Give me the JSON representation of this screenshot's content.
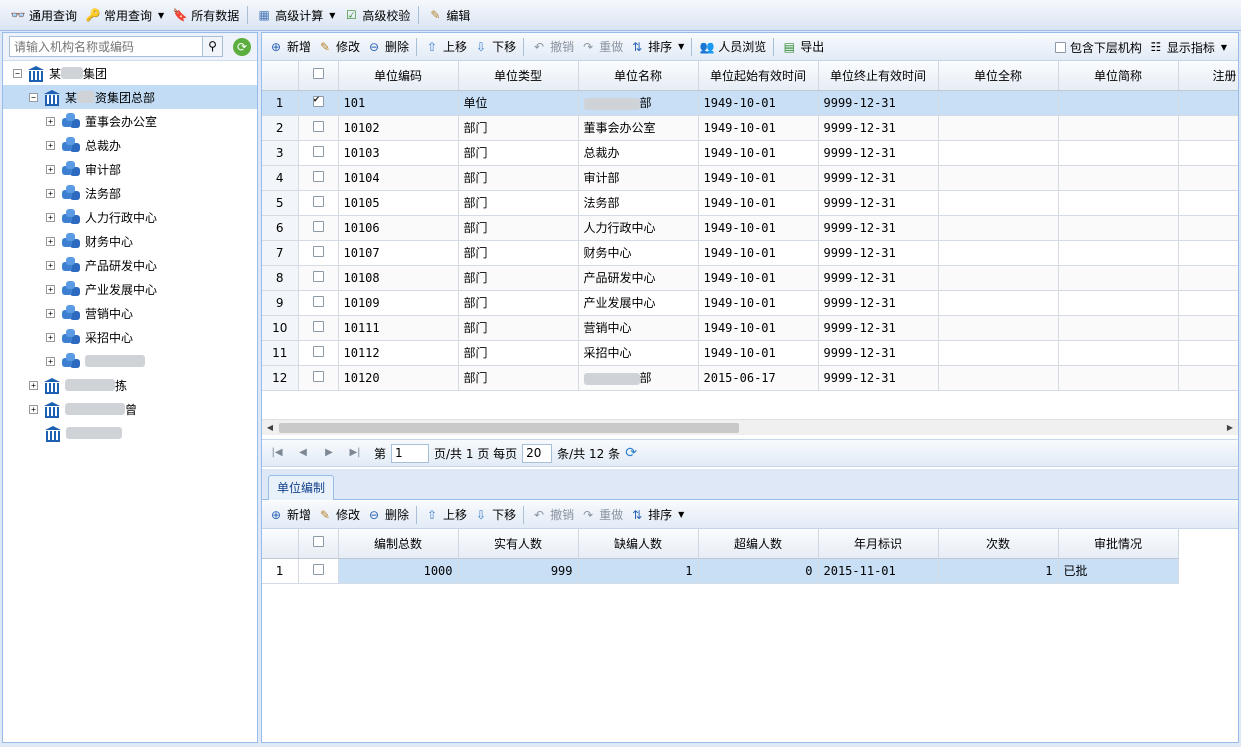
{
  "topbar": {
    "items": [
      {
        "label": "通用查询",
        "icon": "binoculars-icon",
        "dropdown": false
      },
      {
        "label": "常用查询",
        "icon": "query-icon",
        "dropdown": true
      },
      {
        "label": "所有数据",
        "icon": "data-icon",
        "dropdown": false
      },
      {
        "label": "高级计算",
        "icon": "calc-icon",
        "dropdown": true
      },
      {
        "label": "高级校验",
        "icon": "check-icon",
        "dropdown": false
      },
      {
        "label": "编辑",
        "icon": "edit-icon",
        "dropdown": false
      }
    ]
  },
  "tree": {
    "search_placeholder": "请输入机构名称或编码",
    "root": {
      "label_a": "某",
      "label_b": "集团"
    },
    "hq": {
      "label_a": "某",
      "label_b": "资集团总部"
    },
    "children": [
      "董事会办公室",
      "总裁办",
      "审计部",
      "法务部",
      "人力行政中心",
      "财务中心",
      "产品研发中心",
      "产业发展中心",
      "营销中心",
      "采招中心"
    ],
    "tail_suffix_1": "拣",
    "tail_suffix_2": "曾"
  },
  "grid_toolbar": {
    "add": "新增",
    "edit": "修改",
    "delete": "删除",
    "up": "上移",
    "down": "下移",
    "undo": "撤销",
    "redo": "重做",
    "sort": "排序",
    "browse": "人员浏览",
    "export": "导出",
    "include_sub": "包含下层机构",
    "show_index": "显示指标"
  },
  "main_grid": {
    "columns": [
      "单位编码",
      "单位类型",
      "单位名称",
      "单位起始有效时间",
      "单位终止有效时间",
      "单位全称",
      "单位简称",
      "注册"
    ],
    "rows": [
      {
        "n": "1",
        "code": "101",
        "type": "单位",
        "name": "",
        "name_suffix": "部",
        "start": "1949-10-01",
        "end": "9999-12-31",
        "checked": true
      },
      {
        "n": "2",
        "code": "10102",
        "type": "部门",
        "name": "董事会办公室",
        "name_suffix": "",
        "start": "1949-10-01",
        "end": "9999-12-31",
        "checked": false
      },
      {
        "n": "3",
        "code": "10103",
        "type": "部门",
        "name": "总裁办",
        "name_suffix": "",
        "start": "1949-10-01",
        "end": "9999-12-31",
        "checked": false
      },
      {
        "n": "4",
        "code": "10104",
        "type": "部门",
        "name": "审计部",
        "name_suffix": "",
        "start": "1949-10-01",
        "end": "9999-12-31",
        "checked": false
      },
      {
        "n": "5",
        "code": "10105",
        "type": "部门",
        "name": "法务部",
        "name_suffix": "",
        "start": "1949-10-01",
        "end": "9999-12-31",
        "checked": false
      },
      {
        "n": "6",
        "code": "10106",
        "type": "部门",
        "name": "人力行政中心",
        "name_suffix": "",
        "start": "1949-10-01",
        "end": "9999-12-31",
        "checked": false
      },
      {
        "n": "7",
        "code": "10107",
        "type": "部门",
        "name": "财务中心",
        "name_suffix": "",
        "start": "1949-10-01",
        "end": "9999-12-31",
        "checked": false
      },
      {
        "n": "8",
        "code": "10108",
        "type": "部门",
        "name": "产品研发中心",
        "name_suffix": "",
        "start": "1949-10-01",
        "end": "9999-12-31",
        "checked": false
      },
      {
        "n": "9",
        "code": "10109",
        "type": "部门",
        "name": "产业发展中心",
        "name_suffix": "",
        "start": "1949-10-01",
        "end": "9999-12-31",
        "checked": false
      },
      {
        "n": "10",
        "code": "10111",
        "type": "部门",
        "name": "营销中心",
        "name_suffix": "",
        "start": "1949-10-01",
        "end": "9999-12-31",
        "checked": false
      },
      {
        "n": "11",
        "code": "10112",
        "type": "部门",
        "name": "采招中心",
        "name_suffix": "",
        "start": "1949-10-01",
        "end": "9999-12-31",
        "checked": false
      },
      {
        "n": "12",
        "code": "10120",
        "type": "部门",
        "name": "",
        "name_suffix": "部",
        "start": "2015-06-17",
        "end": "9999-12-31",
        "checked": false
      }
    ]
  },
  "pager": {
    "page_prefix": "第",
    "page": "1",
    "page_mid": "页/共 1 页 每页",
    "per_page": "20",
    "page_suffix": "条/共 12 条"
  },
  "sub_tab": {
    "label": "单位编制"
  },
  "sub_grid": {
    "columns": [
      "编制总数",
      "实有人数",
      "缺编人数",
      "超编人数",
      "年月标识",
      "次数",
      "审批情况"
    ],
    "rows": [
      {
        "n": "1",
        "total": "1000",
        "actual": "999",
        "lack": "1",
        "over": "0",
        "ym": "2015-11-01",
        "times": "1",
        "approval": "已批"
      }
    ]
  }
}
